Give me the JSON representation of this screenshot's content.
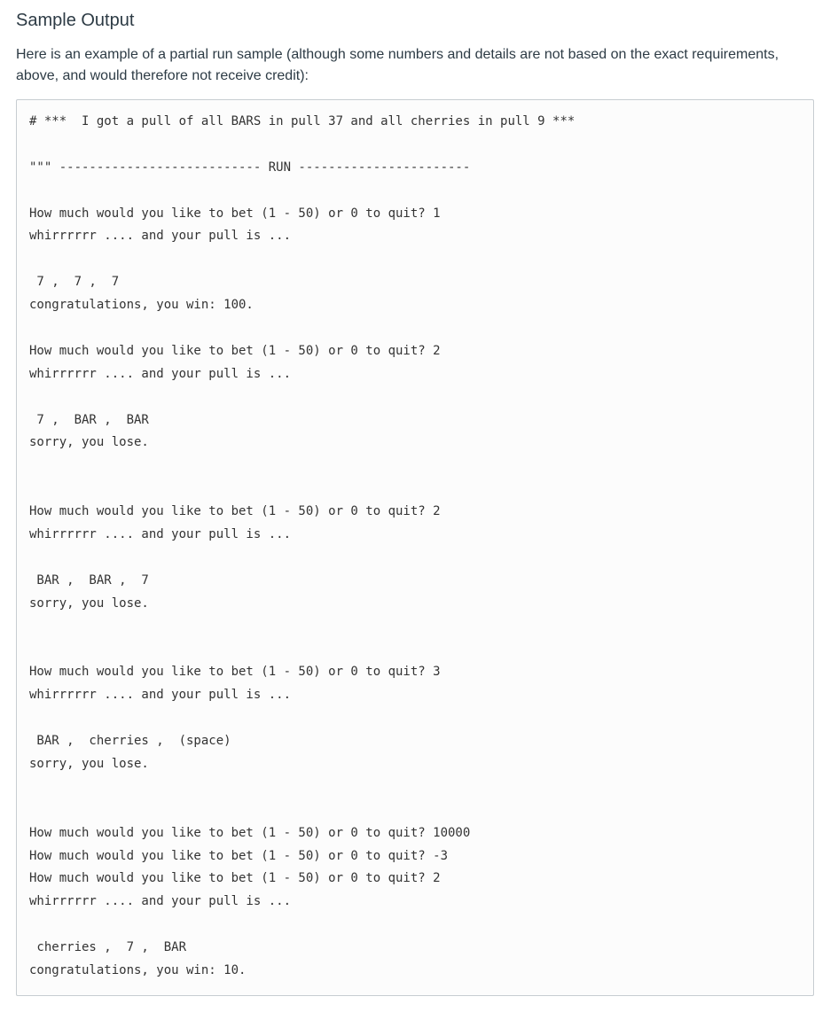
{
  "heading": "Sample Output",
  "intro": "Here is an example of a partial run sample (although some numbers and details are not based on the exact requirements, above, and would therefore not receive credit):",
  "code": "# ***  I got a pull of all BARS in pull 37 and all cherries in pull 9 ***\n\n\"\"\" --------------------------- RUN -----------------------\n\nHow much would you like to bet (1 - 50) or 0 to quit? 1\nwhirrrrrr .... and your pull is ...\n\n 7 ,  7 ,  7\ncongratulations, you win: 100.\n\nHow much would you like to bet (1 - 50) or 0 to quit? 2\nwhirrrrrr .... and your pull is ...\n\n 7 ,  BAR ,  BAR\nsorry, you lose.\n\n\nHow much would you like to bet (1 - 50) or 0 to quit? 2\nwhirrrrrr .... and your pull is ...\n\n BAR ,  BAR ,  7\nsorry, you lose.\n\n\nHow much would you like to bet (1 - 50) or 0 to quit? 3\nwhirrrrrr .... and your pull is ...\n\n BAR ,  cherries ,  (space)\nsorry, you lose.\n\n\nHow much would you like to bet (1 - 50) or 0 to quit? 10000\nHow much would you like to bet (1 - 50) or 0 to quit? -3\nHow much would you like to bet (1 - 50) or 0 to quit? 2\nwhirrrrrr .... and your pull is ...\n\n cherries ,  7 ,  BAR\ncongratulations, you win: 10."
}
